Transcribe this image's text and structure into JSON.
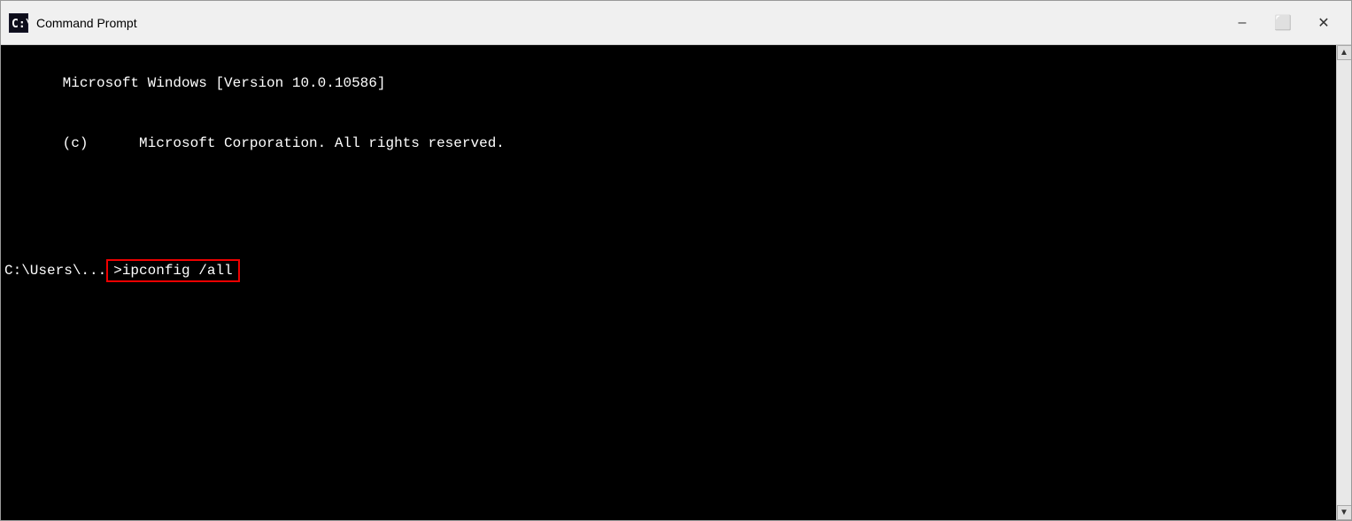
{
  "titlebar": {
    "title": "Command Prompt",
    "icon": "cmd-icon",
    "minimize_label": "–",
    "maximize_label": "⬜",
    "close_label": "✕"
  },
  "terminal": {
    "line1": "Microsoft Windows [Version 10.0.10586]",
    "line2": "(c)      Microsoft Corporation. All rights reserved.",
    "line3": "",
    "prompt": "C:\\Users\\...",
    "command": ">ipconfig /all"
  }
}
